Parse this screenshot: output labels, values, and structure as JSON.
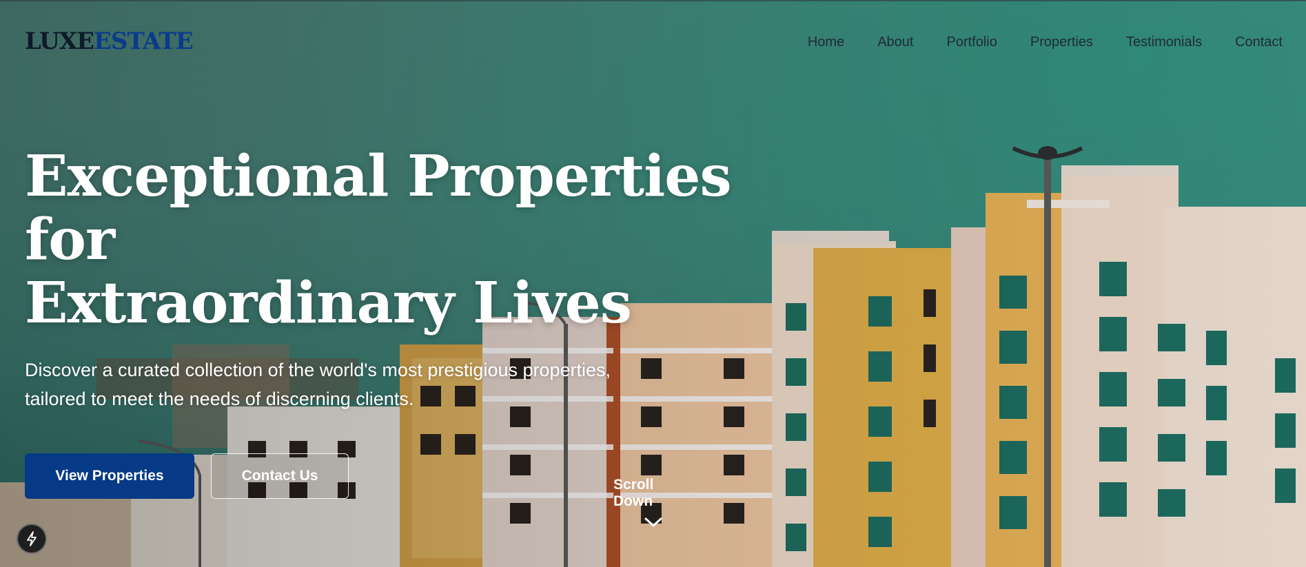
{
  "brand": {
    "logo_part1": "LUXE",
    "logo_part2": "ESTATE",
    "colors": {
      "dark": "#0e1a2a",
      "accent": "#0a3b8a"
    }
  },
  "nav": {
    "items": [
      "Home",
      "About",
      "Portfolio",
      "Properties",
      "Testimonials",
      "Contact"
    ]
  },
  "hero": {
    "headline_line1": "Exceptional Properties for",
    "headline_line2": "Extraordinary Lives",
    "subtext_line1": "Discover a curated collection of the world's most prestigious properties,",
    "subtext_line2": "tailored to meet the needs of discerning clients.",
    "primary_button": "View Properties",
    "secondary_button": "Contact Us",
    "scroll_label": "Scroll Down",
    "primary_color": "#063a86"
  },
  "icons": {
    "scroll": "chevron-down-icon",
    "floating": "lightning-bolt-icon"
  }
}
